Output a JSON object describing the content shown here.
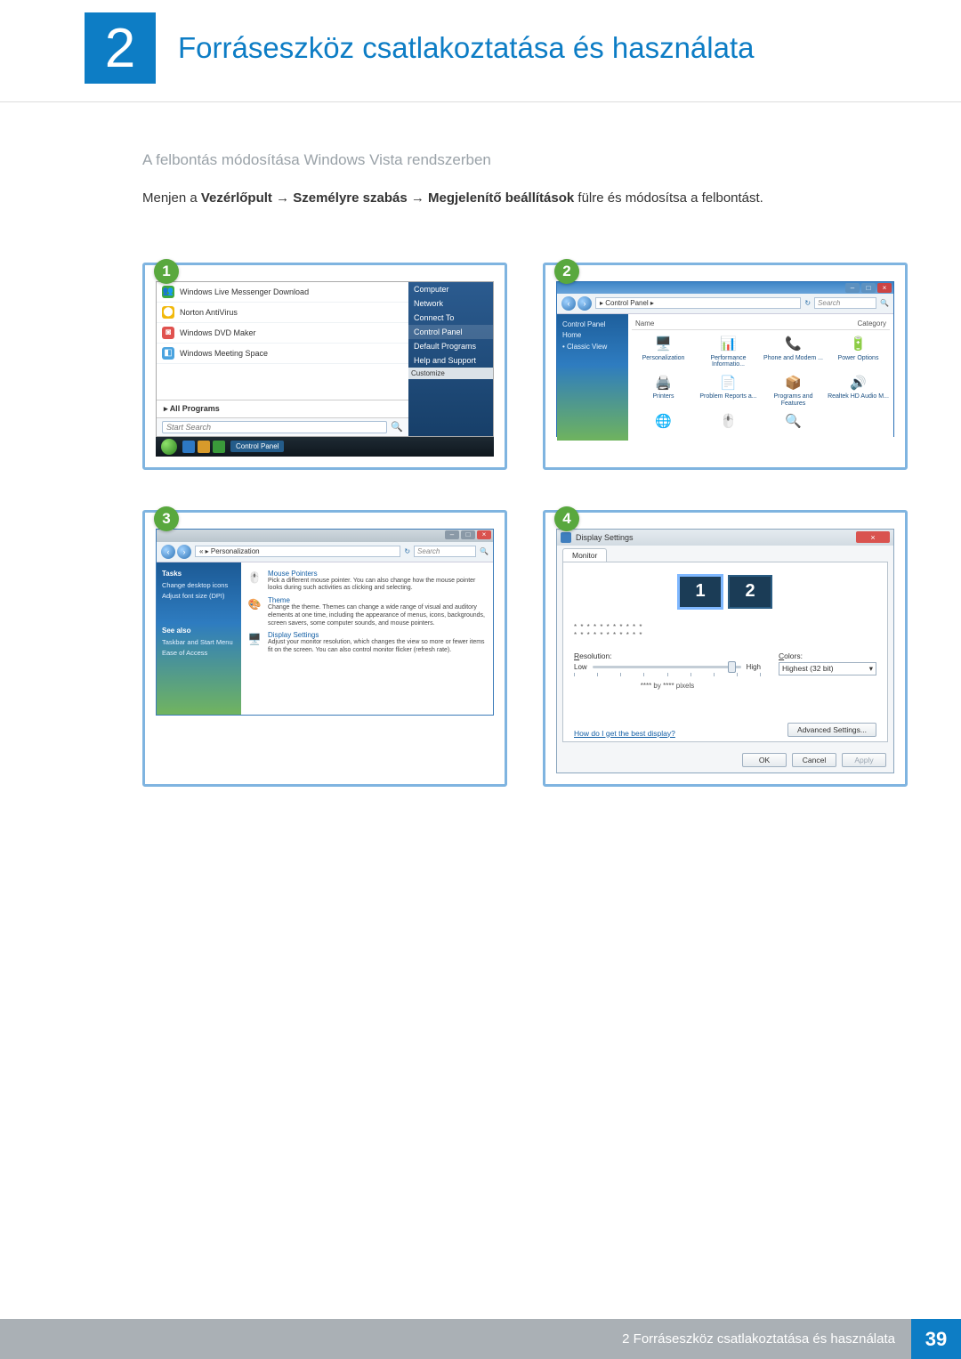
{
  "chapter": {
    "number": "2",
    "title": "Forráseszköz csatlakoztatása és használata"
  },
  "section_heading": "A felbontás módosítása Windows Vista rendszerben",
  "instruction": {
    "prefix": "Menjen a ",
    "path": [
      "Vezérlőpult",
      "Személyre szabás",
      "Megjelenítő beállítások"
    ],
    "arrow": "→",
    "suffix": " fülre és módosítsa a felbontást."
  },
  "badges": [
    "1",
    "2",
    "3",
    "4"
  ],
  "shot1": {
    "left_items": [
      {
        "icon_bg": "#3eaa3e",
        "icon": "👥",
        "label": "Windows Live Messenger Download"
      },
      {
        "icon_bg": "#f2b90c",
        "icon": "⬤",
        "label": "Norton AntiVirus"
      },
      {
        "icon_bg": "#e0524f",
        "icon": "◙",
        "label": "Windows DVD Maker"
      },
      {
        "icon_bg": "#4aa3df",
        "icon": "◧",
        "label": "Windows Meeting Space"
      }
    ],
    "all_programs": "All Programs",
    "search_placeholder": "Start Search",
    "right_items": [
      "Computer",
      "Network",
      "Connect To",
      "Control Panel",
      "Default Programs",
      "Help and Support"
    ],
    "right_highlight_index": 3,
    "customize": "Customize",
    "taskbar_label": "Control Panel"
  },
  "shot2": {
    "breadcrumb": "▸ Control Panel ▸",
    "search_placeholder": "Search",
    "side": {
      "home": "Control Panel Home",
      "classic": "Classic View"
    },
    "columns": [
      "Name",
      "Category"
    ],
    "icons": [
      {
        "glyph": "🖥️",
        "label": "Personalization"
      },
      {
        "glyph": "📊",
        "label": "Performance Informatio..."
      },
      {
        "glyph": "📞",
        "label": "Phone and Modem ..."
      },
      {
        "glyph": "🔋",
        "label": "Power Options"
      },
      {
        "glyph": "🖨️",
        "label": "Printers"
      },
      {
        "glyph": "📄",
        "label": "Problem Reports a..."
      },
      {
        "glyph": "📦",
        "label": "Programs and Features"
      },
      {
        "glyph": "🔊",
        "label": "Realtek HD Audio M..."
      },
      {
        "glyph": "🌐",
        "label": ""
      },
      {
        "glyph": "🖱️",
        "label": ""
      },
      {
        "glyph": "🔍",
        "label": ""
      },
      {
        "glyph": "",
        "label": ""
      }
    ]
  },
  "shot3": {
    "breadcrumb": "« ▸ Personalization",
    "search_placeholder": "Search",
    "side": {
      "tasks_hd": "Tasks",
      "tasks": [
        "Change desktop icons",
        "Adjust font size (DPI)"
      ],
      "seealso_hd": "See also",
      "seealso": [
        "Taskbar and Start Menu",
        "Ease of Access"
      ]
    },
    "items": [
      {
        "title": "Mouse Pointers",
        "desc": "Pick a different mouse pointer. You can also change how the mouse pointer looks during such activities as clicking and selecting."
      },
      {
        "title": "Theme",
        "desc": "Change the theme. Themes can change a wide range of visual and auditory elements at one time, including the appearance of menus, icons, backgrounds, screen savers, some computer sounds, and mouse pointers."
      },
      {
        "title": "Display Settings",
        "desc": "Adjust your monitor resolution, which changes the view so more or fewer items fit on the screen. You can also control monitor flicker (refresh rate)."
      }
    ]
  },
  "shot4": {
    "title": "Display Settings",
    "tab": "Monitor",
    "monitors": [
      "1",
      "2"
    ],
    "placeholder_rows": [
      "* * * * * * * * * * *",
      "* * * * * * * * * * *"
    ],
    "resolution_label": "Resolution:",
    "low": "Low",
    "high": "High",
    "pixels": "**** by **** pixels",
    "colors_label": "Colors:",
    "colors_value": "Highest (32 bit)",
    "help_link": "How do I get the best display?",
    "advanced": "Advanced Settings...",
    "buttons": {
      "ok": "OK",
      "cancel": "Cancel",
      "apply": "Apply"
    }
  },
  "footer": {
    "text": "2 Forráseszköz csatlakoztatása és használata",
    "page": "39"
  }
}
